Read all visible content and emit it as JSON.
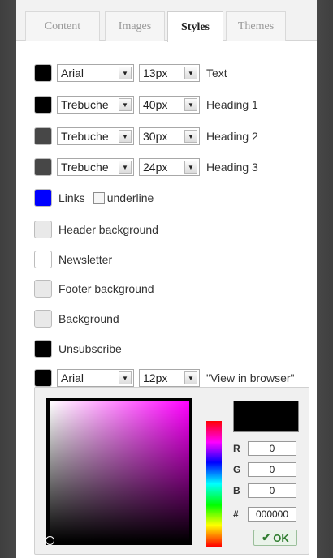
{
  "tabs": [
    "Content",
    "Images",
    "Styles",
    "Themes"
  ],
  "active_tab": "Styles",
  "styles": {
    "text": {
      "color": "#000000",
      "font": "Arial",
      "size": "13px",
      "label": "Text"
    },
    "h1": {
      "color": "#000000",
      "font": "Trebuche",
      "size": "40px",
      "label": "Heading 1"
    },
    "h2": {
      "color": "#474747",
      "font": "Trebuche",
      "size": "30px",
      "label": "Heading 2"
    },
    "h3": {
      "color": "#474747",
      "font": "Trebuche",
      "size": "24px",
      "label": "Heading 3"
    },
    "links": {
      "color": "#0000ff",
      "label": "Links",
      "underline_label": "underline"
    },
    "header_bg": {
      "color": "#e9e9e9",
      "label": "Header background"
    },
    "newsletter": {
      "color": "#ffffff",
      "label": "Newsletter"
    },
    "footer_bg": {
      "color": "#e9e9e9",
      "label": "Footer background"
    },
    "background": {
      "color": "#e9e9e9",
      "label": "Background"
    },
    "unsubscribe": {
      "color": "#000000",
      "label": "Unsubscribe"
    },
    "view_in_browser": {
      "color": "#000000",
      "font": "Arial",
      "size": "12px",
      "label": "\"View in browser\""
    }
  },
  "color_picker": {
    "r_label": "R",
    "g_label": "G",
    "b_label": "B",
    "hex_label": "#",
    "r": "0",
    "g": "0",
    "b": "0",
    "hex": "000000",
    "hue_position": 0.36,
    "ok_label": "OK",
    "ok_icon": "check-icon"
  }
}
